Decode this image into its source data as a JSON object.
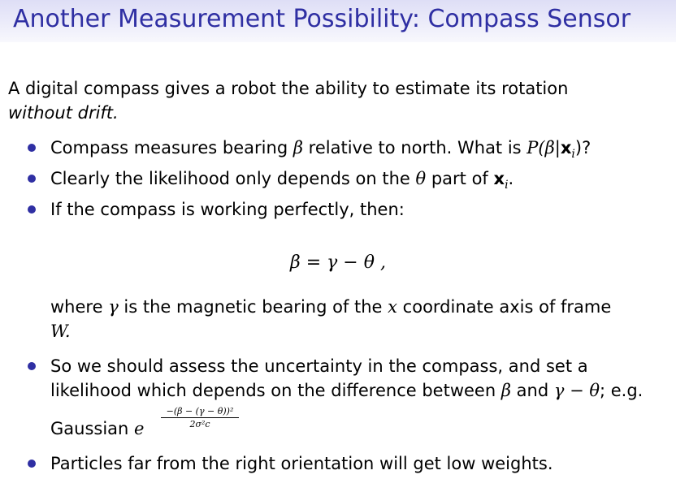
{
  "title": "Another Measurement Possibility: Compass Sensor",
  "intro": {
    "line1": "A digital compass gives a robot the ability to estimate its rotation",
    "line2": "without drift."
  },
  "bullets": [
    {
      "prefix": "Compass measures bearing ",
      "sym1": "β",
      "middle": " relative to north. What is ",
      "expr": "P(β|",
      "bold": "x",
      "sub": "i",
      "suffix": ")?"
    },
    {
      "prefix": "Clearly the likelihood only depends on the ",
      "sym1": "θ",
      "middle": " part of ",
      "bold": "x",
      "sub": "i",
      "suffix": "."
    },
    {
      "text": "If the compass is working perfectly, then:"
    },
    {
      "line1": "So we should assess the uncertainty in the compass, and set a",
      "line2_prefix": "likelihood which depends on the difference between ",
      "line2_sym1": "β",
      "line2_mid": " and ",
      "line2_sym2": "γ − θ",
      "line2_suffix": "; e.g.",
      "line3_prefix": "Gaussian ",
      "line3_e": "e",
      "exp_num": "−(β − (γ − θ))²",
      "exp_den": "2σ²c"
    },
    {
      "text": "Particles far from the right orientation will get low weights."
    }
  ],
  "equation": "β = γ − θ ,",
  "where": {
    "prefix": "where ",
    "sym": "γ",
    "middle": " is the magnetic bearing of the ",
    "x": "x",
    "suffix": " coordinate axis of frame",
    "line2": "W."
  },
  "colors": {
    "title": "#2f2fa3",
    "bullet": "#2f2fa3"
  }
}
